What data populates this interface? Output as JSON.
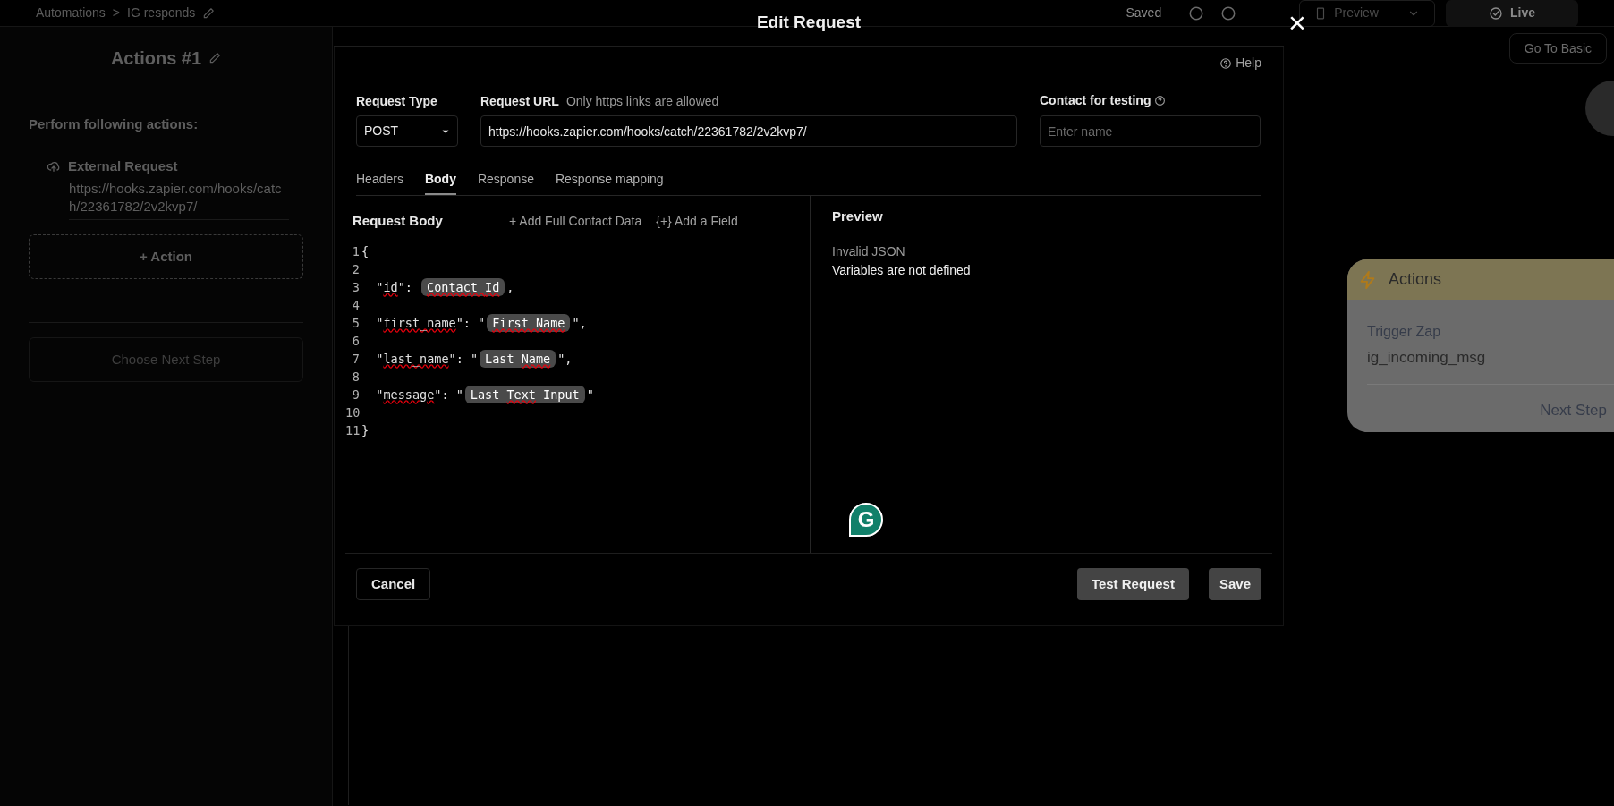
{
  "top_bar": {
    "breadcrumb": [
      "Automations",
      "IG responds"
    ],
    "separator": ">",
    "saved": "Saved",
    "preview_button": "Preview",
    "live_button": "Live",
    "basic_button": "Go To Basic"
  },
  "left_panel": {
    "title": "Actions #1",
    "section_label": "Perform following actions:",
    "actions": [
      {
        "title": "External Request",
        "url": "https://hooks.zapier.com/hooks/catch/22361782/2v2kvp7/"
      }
    ],
    "add_action": "+ Action",
    "next_step": "Choose Next Step"
  },
  "canvas_card": {
    "title": "Actions",
    "label": "Trigger Zap",
    "value": "ig_incoming_msg",
    "next": "Next Step"
  },
  "modal": {
    "title": "Edit Request",
    "close": "×",
    "help": "Help",
    "request_type": {
      "label": "Request Type",
      "value": "POST"
    },
    "request_url": {
      "label": "Request URL",
      "hint": "Only https links are allowed",
      "value": "https://hooks.zapier.com/hooks/catch/22361782/2v2kvp7/"
    },
    "contact": {
      "label": "Contact for testing",
      "placeholder": "Enter name"
    },
    "tabs": [
      {
        "label": "Headers",
        "selected": false
      },
      {
        "label": "Body",
        "selected": true
      },
      {
        "label": "Response",
        "selected": false
      },
      {
        "label": "Response mapping",
        "selected": false
      }
    ],
    "body": {
      "title": "Request Body",
      "add_contact": "+ Add Full Contact Data",
      "add_field": "{+} Add a Field",
      "lines": [
        {
          "number": "1",
          "segments": [
            {
              "kind": "plain",
              "text": "{"
            }
          ]
        },
        {
          "number": "2"
        },
        {
          "number": "3",
          "segments": [
            {
              "kind": "plain",
              "text": "  \""
            },
            {
              "kind": "plain",
              "text": "id",
              "flagged": true
            },
            {
              "kind": "plain",
              "text": "\": "
            },
            {
              "kind": "chip",
              "parts": [
                {
                  "text": "Contact ",
                  "flagged": true
                },
                {
                  "text": "Id",
                  "flagged": true
                }
              ]
            },
            {
              "kind": "plain",
              "text": ","
            }
          ]
        },
        {
          "number": "4"
        },
        {
          "number": "5",
          "segments": [
            {
              "kind": "plain",
              "text": "  \""
            },
            {
              "kind": "plain",
              "text": "first_name",
              "flagged": true
            },
            {
              "kind": "plain",
              "text": "\": \""
            },
            {
              "kind": "chip",
              "parts": [
                {
                  "text": "First ",
                  "flagged": true
                },
                {
                  "text": "Name",
                  "flagged": true
                }
              ]
            },
            {
              "kind": "plain",
              "text": "\","
            }
          ]
        },
        {
          "number": "6"
        },
        {
          "number": "7",
          "segments": [
            {
              "kind": "plain",
              "text": "  \""
            },
            {
              "kind": "plain",
              "text": "last_name",
              "flagged": true
            },
            {
              "kind": "plain",
              "text": "\": \""
            },
            {
              "kind": "chip",
              "parts": [
                {
                  "text": "Last "
                },
                {
                  "text": "Name",
                  "flagged": true
                }
              ]
            },
            {
              "kind": "plain",
              "text": "\","
            }
          ]
        },
        {
          "number": "8"
        },
        {
          "number": "9",
          "segments": [
            {
              "kind": "plain",
              "text": "  \""
            },
            {
              "kind": "plain",
              "text": "message",
              "flagged": true
            },
            {
              "kind": "plain",
              "text": "\": \""
            },
            {
              "kind": "chip",
              "parts": [
                {
                  "text": "Last "
                },
                {
                  "text": "Text",
                  "flagged": true
                },
                {
                  "text": " Input"
                }
              ]
            },
            {
              "kind": "plain",
              "text": "\""
            }
          ]
        },
        {
          "number": "10"
        },
        {
          "number": "11",
          "segments": [
            {
              "kind": "plain",
              "text": "}"
            }
          ]
        }
      ]
    },
    "preview": {
      "title": "Preview",
      "status": "Invalid JSON",
      "message": "Variables are not defined"
    },
    "grammar_badge": "G",
    "buttons": {
      "cancel": "Cancel",
      "test": "Test Request",
      "save": "Save"
    }
  }
}
